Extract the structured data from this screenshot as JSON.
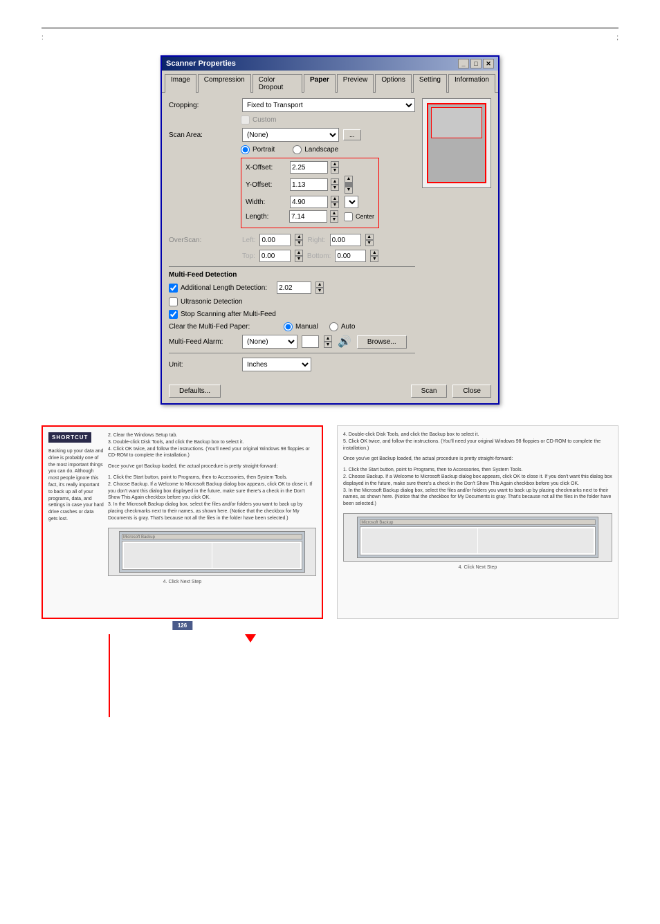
{
  "page": {
    "header_left": ":",
    "header_right": ";"
  },
  "dialog": {
    "title": "Scanner Properties",
    "tabs": [
      "Image",
      "Compression",
      "Color Dropout",
      "Paper",
      "Preview",
      "Options",
      "Setting",
      "Information"
    ],
    "active_tab": "Paper",
    "fields": {
      "cropping_label": "Cropping:",
      "cropping_value": "Fixed to Transport",
      "custom_label": "Custom",
      "scan_area_label": "Scan Area:",
      "scan_area_value": "(None)",
      "portrait_label": "Portrait",
      "landscape_label": "Landscape",
      "x_offset_label": "X-Offset:",
      "x_offset_value": "2.25",
      "y_offset_label": "Y-Offset:",
      "y_offset_value": "1.13",
      "width_label": "Width:",
      "width_value": "4.90",
      "length_label": "Length:",
      "length_value": "7.14",
      "center_label": "Center",
      "overscan_label": "OverScan:",
      "left_label": "Left:",
      "left_value": "0.00",
      "right_label": "Right:",
      "right_value": "0.00",
      "top_label": "Top:",
      "top_value": "0.00",
      "bottom_label": "Bottom:",
      "bottom_value": "0.00",
      "multi_feed_section": "Multi-Feed Detection",
      "additional_length_label": "Additional Length Detection:",
      "additional_length_value": "2.02",
      "additional_length_checked": true,
      "ultrasonic_label": "Ultrasonic Detection",
      "ultrasonic_checked": false,
      "stop_scanning_label": "Stop Scanning after Multi-Feed",
      "stop_scanning_checked": true,
      "clear_paper_label": "Clear the Multi-Fed Paper:",
      "manual_label": "Manual",
      "auto_label": "Auto",
      "manual_checked": true,
      "auto_checked": false,
      "multi_feed_alarm_label": "Multi-Feed Alarm:",
      "multi_feed_alarm_value": "(None)",
      "browse_label": "Browse...",
      "unit_label": "Unit:",
      "unit_value": "Inches",
      "defaults_label": "Defaults...",
      "scan_label": "Scan",
      "close_label": "Close"
    }
  },
  "book_left": {
    "shortcut_label": "SHORTCUT",
    "caption_text": "4. Click Next Step",
    "text_lines": [
      "2. Clear the Windows Setup tab.",
      "3. Double-click Disk Tools, and click the Backup box to select it.",
      "4. Click OK twice, and follow the instructions. (You'll need your original Windows 98 floppies or CD-ROM to complete the installation.)",
      "Once you've got Backup loaded, the actual procedure is pretty straight-forward:",
      "1. Click the Start button, point to Programs, then to Accessories, then System Tools.",
      "2. Choose Backup. If a Welcome to Microsoft Backup dialog box appears, click OK to close it. If you don't want this dialog box displayed in the future, make sure there's a check in the Don't Show This Again checkbox before you click OK.",
      "3. In the Microsoft Backup dialog box, select the files and/or folders you want to back up by placing checkmarks next to their names, as shown here. (Notice that the checkbox for My Documents is gray. That's because not all the files in the folder have been selected.)"
    ]
  },
  "book_right": {
    "caption_text": "4. Click Next Step",
    "text_lines": [
      "4. Double-click Disk Tools, and click the Backup box to select it.",
      "5. Click OK twice, and follow the instructions. (You'll need your original Windows 98 floppies or CD-ROM to complete the installation.)",
      "Once you've got Backup loaded, the actual procedure is pretty straight-forward:",
      "1. Click the Start button, point to Programs, then to Accessories, then System Tools.",
      "2. Choose Backup. If a Welcome to Microsoft Backup dialog box appears, click OK to close it. If you don't want this dialog box displayed in the future, make sure there's a check in the Don't Show This Again checkbox before you click OK.",
      "3. In the Microsoft Backup dialog box, select the files and/or folders you want to back up by placing checkmarks next to their names, as shown here. (Notice that the checkbox for My Documents is gray. That's because not all the files in the folder have been selected.)"
    ]
  },
  "page_number": "126",
  "colors": {
    "dialog_title_bg": "#0a246a",
    "tab_active_bg": "#d4d0c8",
    "red_border": "#ff0000",
    "page_num_bg": "#4a5a8a"
  }
}
